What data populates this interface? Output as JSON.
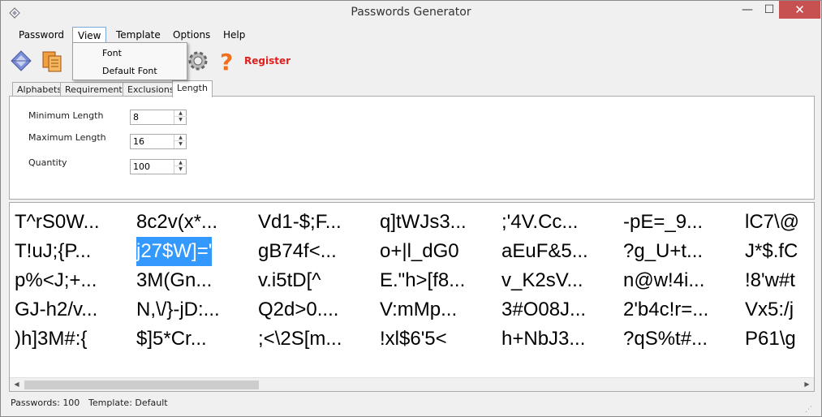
{
  "window": {
    "title": "Passwords Generator",
    "min_glyph": "—",
    "max_glyph": "☐",
    "close_glyph": "✕"
  },
  "menu": {
    "items": [
      "Password",
      "View",
      "Template",
      "Options",
      "Help"
    ],
    "active": "View",
    "dropdown": [
      "Font",
      "Default Font"
    ]
  },
  "toolbar": {
    "register_label": "Register",
    "icons": [
      "generate-icon",
      "copy-icon",
      "settings-icon",
      "help-icon"
    ]
  },
  "tabs": [
    "Alphabets",
    "Requirements",
    "Exclusions",
    "Length"
  ],
  "length_tab": {
    "fields": [
      {
        "label": "Minimum Length",
        "value": "8"
      },
      {
        "label": "Maximum Length",
        "value": "16"
      },
      {
        "label": "Quantity",
        "value": "100"
      }
    ]
  },
  "passwords": [
    [
      "T^rS0W...",
      "8c2v(x*...",
      "Vd1-$;F...",
      "q]tWJs3...",
      ";'4V.Cc...",
      "-pE=_9...",
      "lC7\\@"
    ],
    [
      "T!uJ;{P...",
      "j27$W]='",
      "gB74f<...",
      "o+|l_dG0",
      "aEuF&5...",
      "?g_U+t...",
      "J*$.fC"
    ],
    [
      "p%<J;+...",
      "3M(Gn...",
      "v.i5tD[^",
      "E.\"h>[f8...",
      "v_K2sV...",
      "n@w!4i...",
      "!8'w#t"
    ],
    [
      "GJ-h2/v...",
      "N,\\/}-jD:...",
      "Q2d>0....",
      "V:mMp...",
      "3#O08J...",
      "2'b4c!r=...",
      "Vx5:/j"
    ],
    [
      ")h]3M#:{",
      "$]5*Cr...",
      ";<\\2S[m...",
      "!xl$6'5<",
      "h+NbJ3...",
      "?qS%t#...",
      "P61\\g"
    ]
  ],
  "selected_cell": {
    "row": 1,
    "col": 1
  },
  "status": {
    "passwords": "Passwords: 100",
    "template": "Template: Default"
  },
  "colors": {
    "register": "#e0201c",
    "selection": "#3399ff",
    "close_button": "#c75050"
  }
}
